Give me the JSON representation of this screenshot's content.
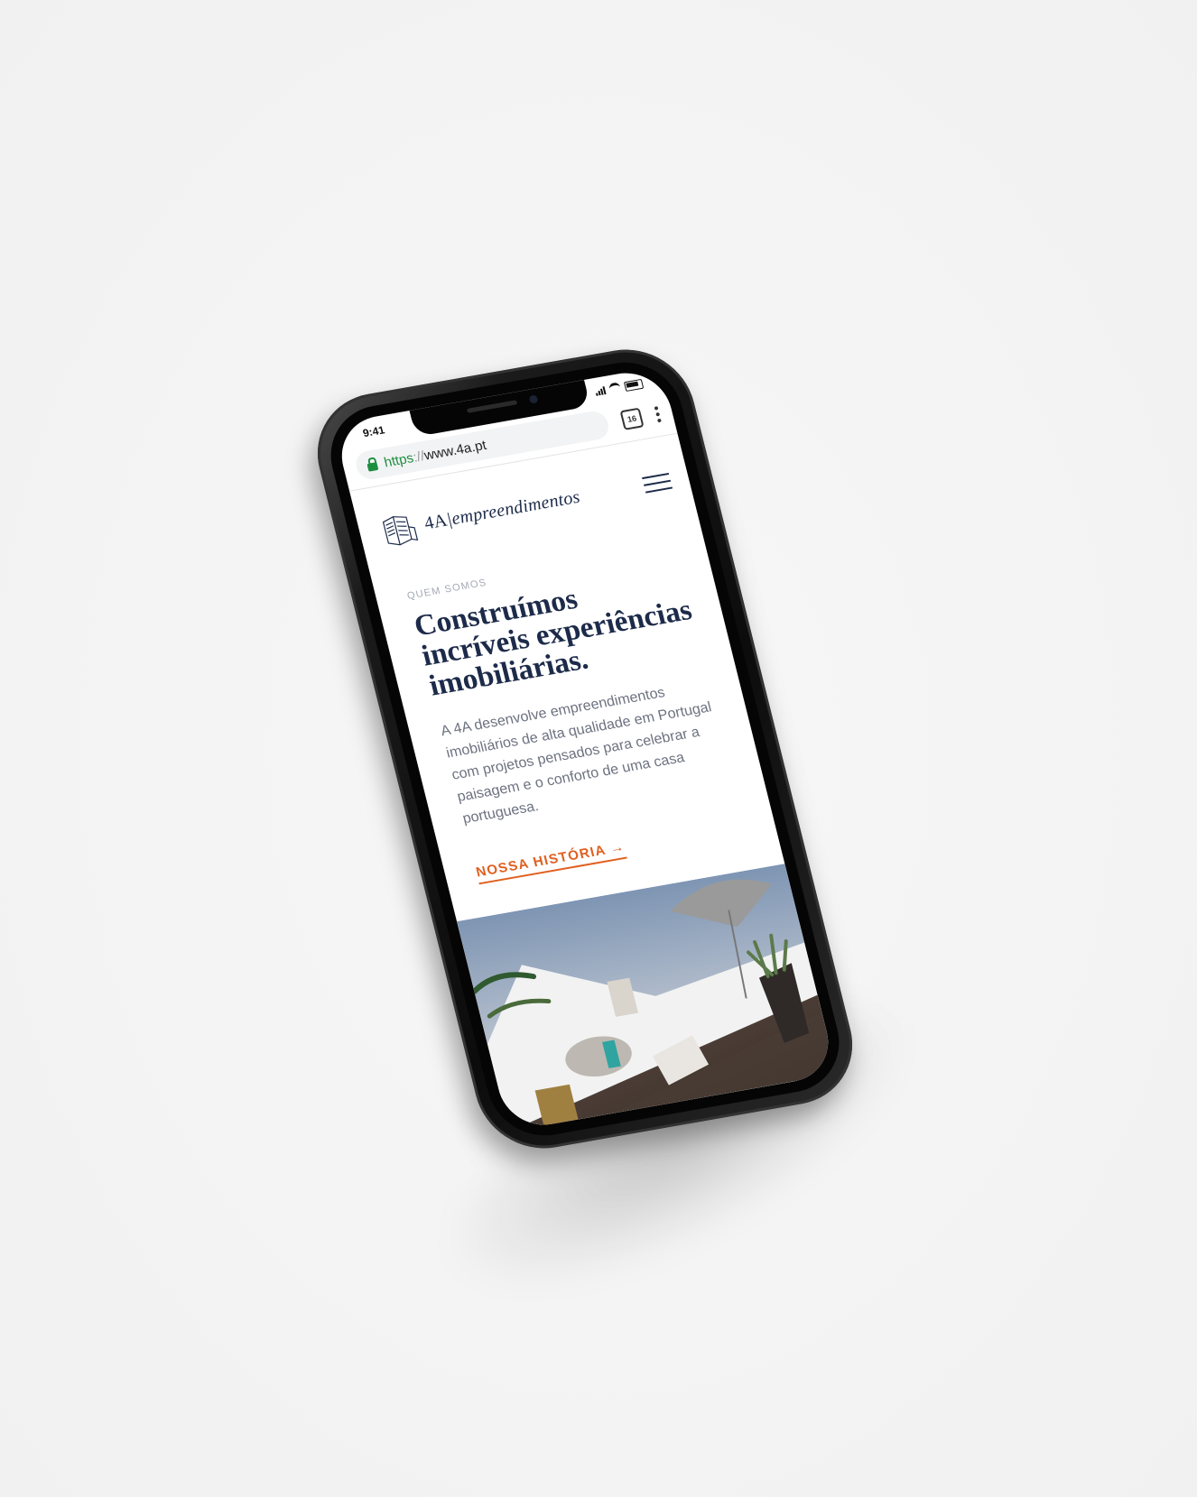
{
  "status_bar": {
    "time": "9:41"
  },
  "browser": {
    "url_scheme": "https",
    "url_sep": "://",
    "url_host": "www.4a.pt",
    "tab_count": "16"
  },
  "site": {
    "logo_4a": "4A",
    "logo_divider": "|",
    "logo_name": "empreendimentos",
    "eyebrow": "QUEM SOMOS",
    "headline": "Construímos incríveis experiências imobiliárias.",
    "body": "A 4A desenvolve empreendimentos imobiliários de alta qualidade em Portugal com projetos pensados para celebrar a paisagem e o conforto de uma casa portuguesa.",
    "cta_label": "NOSSA HISTÓRIA →"
  },
  "colors": {
    "brand_navy": "#1d2b4a",
    "accent_orange": "#e06020",
    "secure_green": "#1e8e3e"
  },
  "icons": [
    "lock-icon",
    "tabs-counter-icon",
    "kebab-menu-icon",
    "hamburger-menu-icon",
    "building-logo-icon"
  ]
}
